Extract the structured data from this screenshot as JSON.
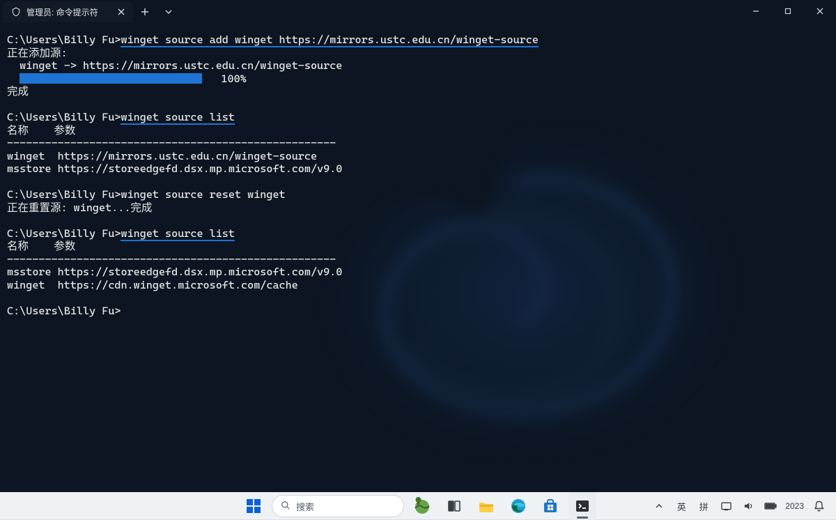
{
  "window": {
    "tab_title": "管理员: 命令提示符"
  },
  "terminal": {
    "prompt": "C:\\Users\\Billy Fu>",
    "cmd1": "winget source add winget https://mirrors.ustc.edu.cn/winget-source",
    "adding_source": "正在添加源:",
    "adding_line": "  winget -> https://mirrors.ustc.edu.cn/winget-source",
    "progress_pct": "100%",
    "done": "完成",
    "cmd2": "winget source list",
    "list_header": "名称    参数",
    "list_sep": "----------------------------------------------------",
    "list1_row1": "winget  https://mirrors.ustc.edu.cn/winget-source",
    "list1_row2": "msstore https://storeedgefd.dsx.mp.microsoft.com/v9.0",
    "cmd3": "winget source reset winget",
    "resetting": "正在重置源: winget...完成",
    "cmd4": "winget source list",
    "list2_row1": "msstore https://storeedgefd.dsx.mp.microsoft.com/v9.0",
    "list2_row2": "winget  https://cdn.winget.microsoft.com/cache"
  },
  "taskbar": {
    "search_placeholder": "搜索",
    "ime_lang": "英",
    "ime_mode": "拼",
    "year": "2023"
  }
}
